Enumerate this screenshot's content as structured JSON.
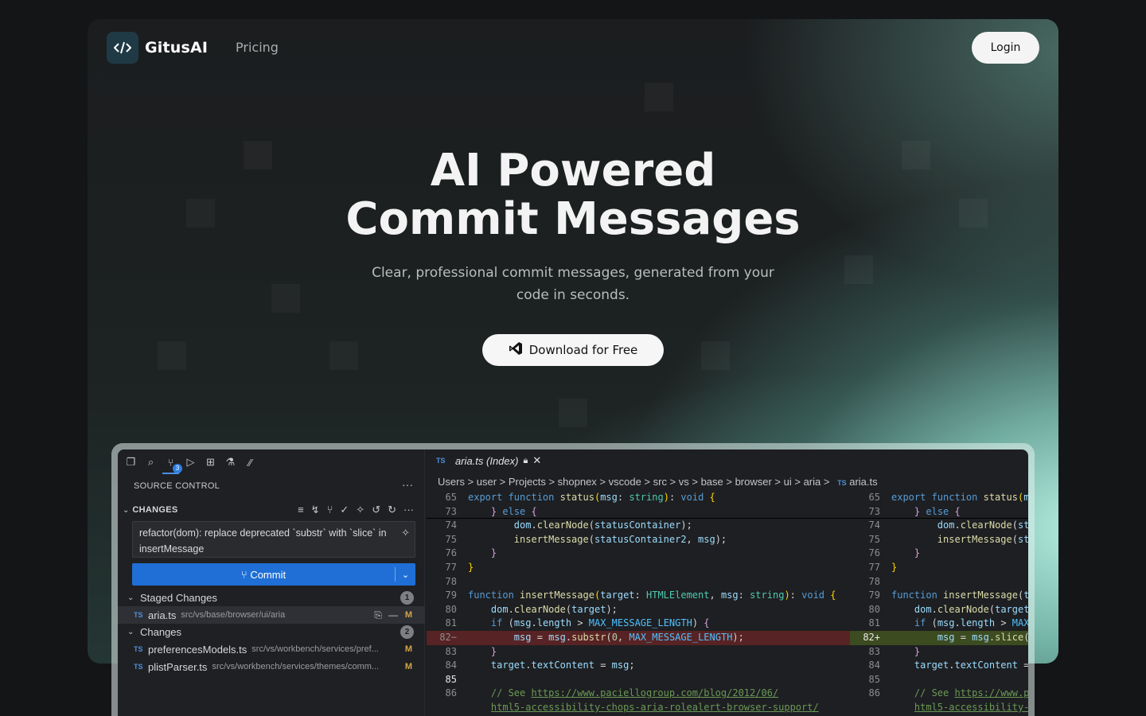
{
  "brand": {
    "name": "GitusAI",
    "logo_glyph": "</>"
  },
  "nav": {
    "pricing": "Pricing",
    "login": "Login"
  },
  "hero": {
    "title_line1": "AI Powered",
    "title_line2": "Commit Messages",
    "subtitle": "Clear, professional commit messages, generated from your code in seconds.",
    "download_label": "Download for Free"
  },
  "colors": {
    "accent": "#1f6fd6",
    "mint": "#bef7e6",
    "background": "#141517"
  },
  "editor": {
    "source_control_title": "SOURCE CONTROL",
    "changes_header": "CHANGES",
    "scm_badge": "3",
    "commit_message": "refactor(dom): replace deprecated `substr` with `slice` in insertMessage",
    "commit_label": "Commit",
    "staged": {
      "label": "Staged Changes",
      "count": "1"
    },
    "staged_files": [
      {
        "type": "TS",
        "name": "aria.ts",
        "path": "src/vs/base/browser/ui/aria",
        "status": "M"
      }
    ],
    "changes": {
      "label": "Changes",
      "count": "2"
    },
    "changed_files": [
      {
        "type": "TS",
        "name": "preferencesModels.ts",
        "path": "src/vs/workbench/services/pref...",
        "status": "M"
      },
      {
        "type": "TS",
        "name": "plistParser.ts",
        "path": "src/vs/workbench/services/themes/comm...",
        "status": "M"
      }
    ],
    "tab": {
      "type": "TS",
      "label": "aria.ts (Index)"
    },
    "breadcrumb": "Users > user > Projects > shopnex > vscode > src > vs > base > browser > ui > aria >",
    "breadcrumb_file": "aria.ts",
    "icons": [
      "files-icon",
      "search-icon",
      "source-control-icon",
      "run-debug-icon",
      "extensions-icon",
      "testing-icon",
      "gitus-icon"
    ]
  }
}
